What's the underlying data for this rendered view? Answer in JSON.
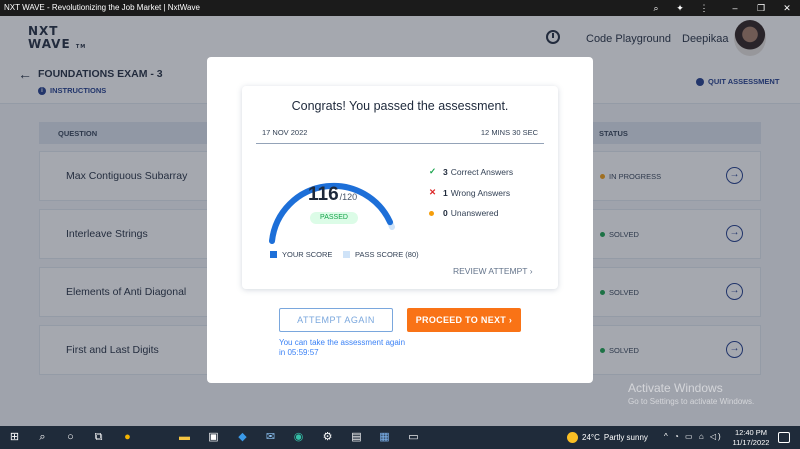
{
  "browser": {
    "title": "NXT WAVE - Revolutionizing the Job Market | NxtWave"
  },
  "header": {
    "logo_line1": "NXT",
    "logo_line2": "WAVE",
    "logo_tm": "TM",
    "code_playground": "Code Playground",
    "user_name": "Deepikaa"
  },
  "exam": {
    "title": "FOUNDATIONS EXAM - 3",
    "instructions": "INSTRUCTIONS",
    "quit": "QUIT ASSESSMENT"
  },
  "table": {
    "headers": {
      "question": "QUESTION",
      "status": "STATUS"
    },
    "rows": [
      {
        "name": "Max Contiguous Subarray",
        "status": "IN PROGRESS",
        "status_color": "#f59e0b"
      },
      {
        "name": "Interleave Strings",
        "status": "SOLVED",
        "status_color": "#16a34a"
      },
      {
        "name": "Elements of Anti Diagonal",
        "status": "SOLVED",
        "status_color": "#16a34a"
      },
      {
        "name": "First and Last Digits",
        "status": "SOLVED",
        "status_color": "#16a34a"
      }
    ]
  },
  "modal": {
    "heading": "Congrats! You passed the assessment.",
    "date": "17 NOV 2022",
    "duration": "12 MINS 30 SEC",
    "score": "116",
    "score_total": "/120",
    "score_fraction": 0.967,
    "passed_badge": "PASSED",
    "stats": {
      "correct_count": "3",
      "correct_label": "Correct Answers",
      "wrong_count": "1",
      "wrong_label": "Wrong Answers",
      "unanswered_count": "0",
      "unanswered_label": "Unanswered"
    },
    "legend": {
      "your_score": "YOUR SCORE",
      "pass_score": "PASS SCORE (80)"
    },
    "review_link": "REVIEW ATTEMPT",
    "attempt_again": "ATTEMPT AGAIN",
    "proceed": "PROCEED TO NEXT",
    "retake_note": "You can take the assessment again in 05:59:57"
  },
  "watermark": {
    "line1": "Activate Windows",
    "line2": "Go to Settings to activate Windows."
  },
  "taskbar": {
    "temperature": "24°C",
    "weather": "Partly sunny",
    "time": "12:40 PM",
    "date": "11/17/2022"
  },
  "colors": {
    "primary": "#1e3a8a",
    "accent_orange": "#f97316",
    "gauge_blue": "#1d6fd8",
    "gauge_track": "#cfe3f8",
    "success": "#16a34a",
    "error": "#dc2626",
    "warning": "#f59e0b"
  }
}
